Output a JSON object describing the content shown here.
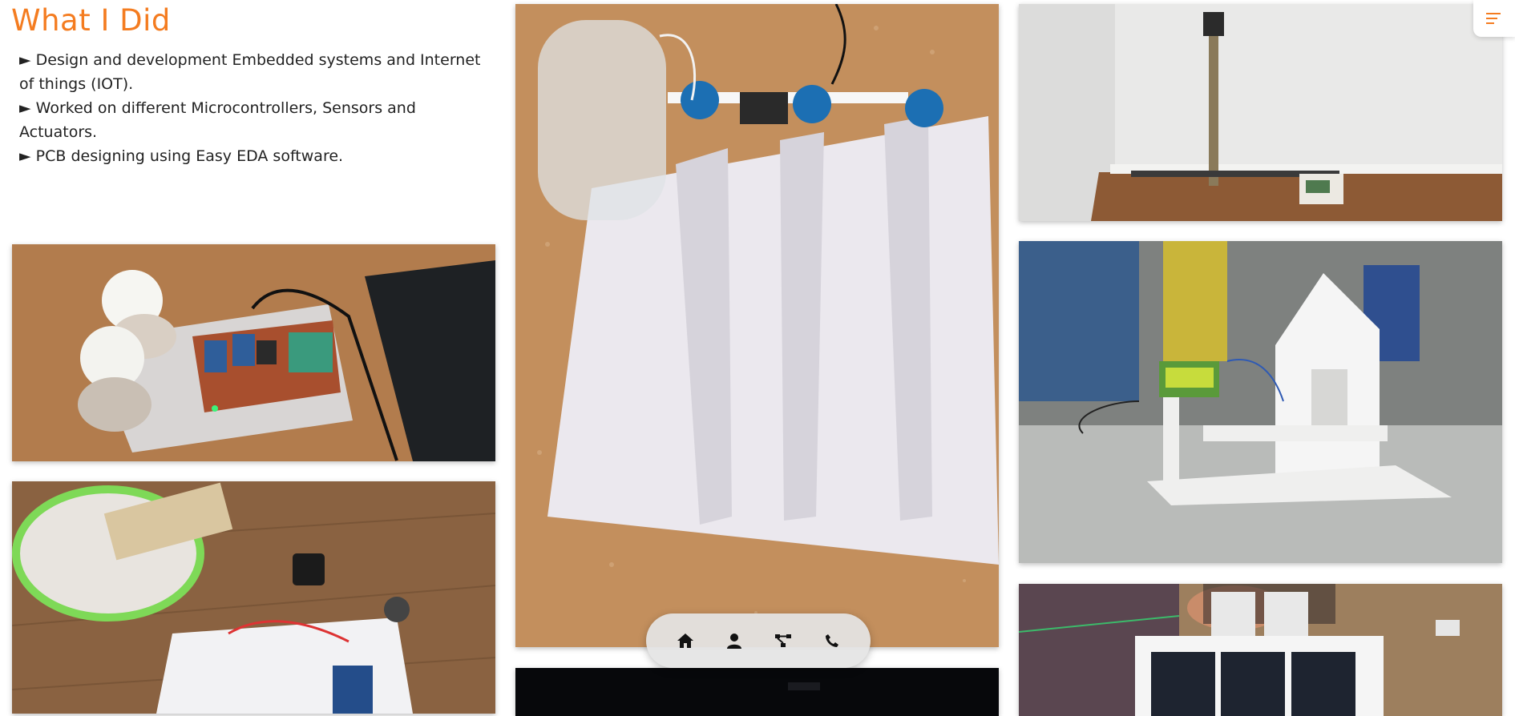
{
  "section": {
    "title": "What I Did",
    "bullets": [
      "► Design and development Embedded systems and Internet of things (IOT).",
      "► Worked on different Microcontrollers, Sensors and Actuators.",
      "► PCB designing using Easy EDA software."
    ]
  },
  "gallery": [
    {
      "subject": "relay-bulb-board"
    },
    {
      "subject": "basket-arduino-project"
    },
    {
      "subject": "irrigation-valves-setup"
    },
    {
      "subject": "dark-project"
    },
    {
      "subject": "vertical-rail-machine"
    },
    {
      "subject": "house-model-lcd"
    },
    {
      "subject": "solar-panel-model"
    }
  ],
  "navigation": {
    "items": [
      "home-icon",
      "user-icon",
      "projects-icon",
      "phone-icon"
    ]
  },
  "theme": {
    "accent": "#f47c20"
  }
}
